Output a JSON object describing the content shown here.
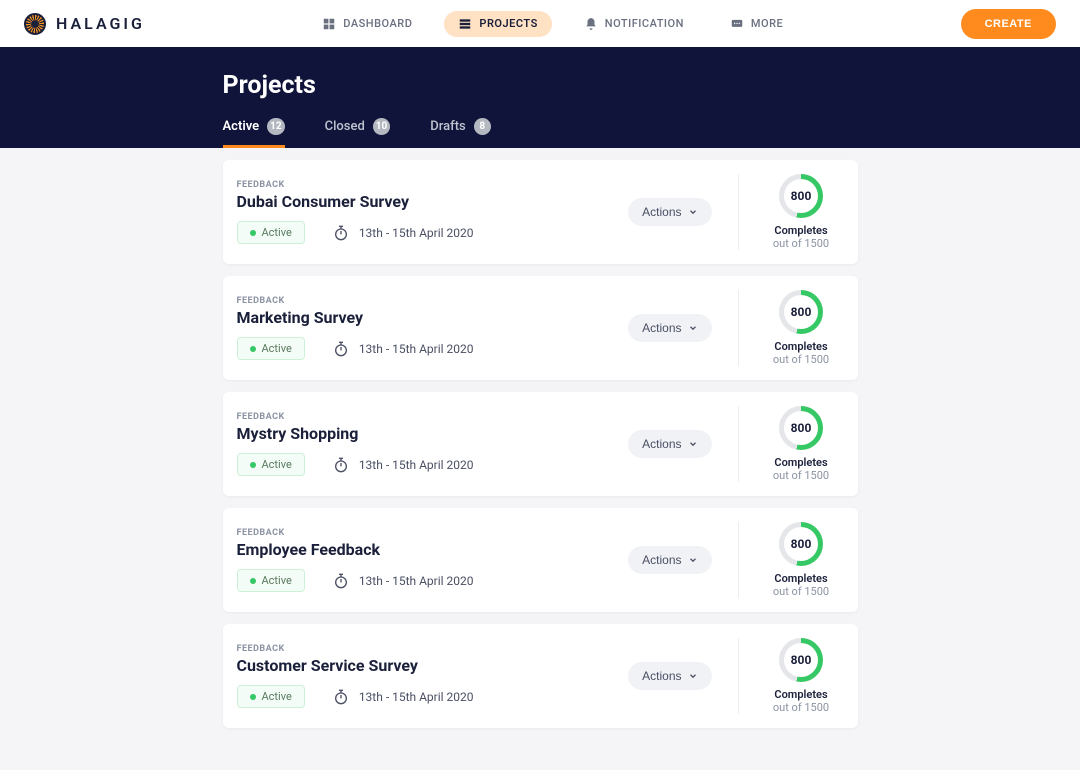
{
  "brand": "HALAGIG",
  "nav": {
    "dashboard": "DASHBOARD",
    "projects": "PROJECTS",
    "notification": "NOTIFICATION",
    "more": "MORE",
    "create": "CREATE"
  },
  "header": {
    "title": "Projects"
  },
  "tabs": {
    "active": {
      "label": "Active",
      "count": "12"
    },
    "closed": {
      "label": "Closed",
      "count": "10"
    },
    "drafts": {
      "label": "Drafts",
      "count": "8"
    }
  },
  "card_common": {
    "kicker": "FEEDBACK",
    "status": "Active",
    "actions_label": "Actions",
    "completes_label": "Completes",
    "completes_sub": "out of 1500",
    "completes_value": "800",
    "date_range": "13th - 15th April 2020"
  },
  "projects": [
    {
      "title": "Dubai Consumer Survey"
    },
    {
      "title": "Marketing Survey"
    },
    {
      "title": "Mystry Shopping"
    },
    {
      "title": "Employee Feedback"
    },
    {
      "title": "Customer Service Survey"
    }
  ]
}
